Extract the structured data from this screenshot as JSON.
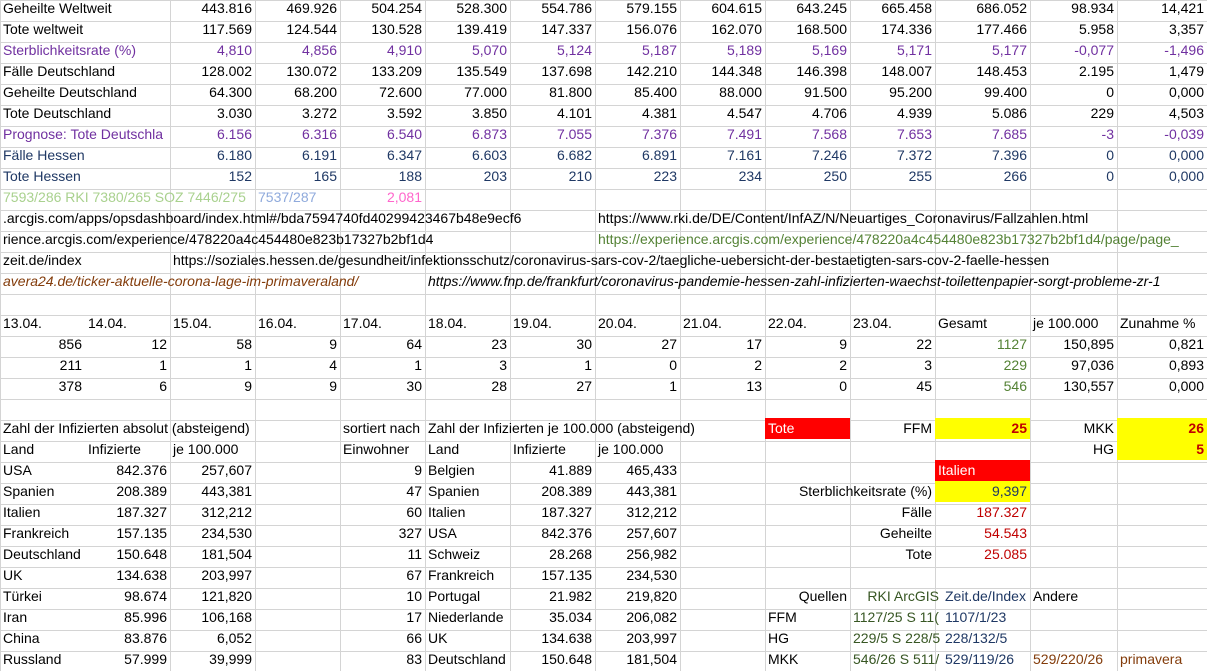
{
  "top": [
    {
      "label": "Geheilte Weltweit",
      "v": [
        "443.816",
        "469.926",
        "504.254",
        "528.300",
        "554.786",
        "579.155",
        "604.615",
        "643.245",
        "665.458",
        "686.052",
        "98.934",
        "14,421"
      ],
      "cls": ""
    },
    {
      "label": "Tote weltweit",
      "v": [
        "117.569",
        "124.544",
        "130.528",
        "139.419",
        "147.337",
        "156.076",
        "162.070",
        "168.500",
        "174.336",
        "177.466",
        "5.958",
        "3,357"
      ],
      "cls": ""
    },
    {
      "label": "Sterblichkeitsrate (%)",
      "v": [
        "4,810",
        "4,856",
        "4,910",
        "5,070",
        "5,124",
        "5,187",
        "5,189",
        "5,169",
        "5,171",
        "5,177",
        "-0,077",
        "-1,496"
      ],
      "cls": "purple"
    },
    {
      "label": "Fälle Deutschland",
      "v": [
        "128.002",
        "130.072",
        "133.209",
        "135.549",
        "137.698",
        "142.210",
        "144.348",
        "146.398",
        "148.007",
        "148.453",
        "2.195",
        "1,479"
      ],
      "cls": ""
    },
    {
      "label": "Geheilte Deutschland",
      "v": [
        "64.300",
        "68.200",
        "72.600",
        "77.000",
        "81.800",
        "85.400",
        "88.000",
        "91.500",
        "95.200",
        "99.400",
        "0",
        "0,000"
      ],
      "cls": ""
    },
    {
      "label": "Tote Deutschland",
      "v": [
        "3.030",
        "3.272",
        "3.592",
        "3.850",
        "4.101",
        "4.381",
        "4.547",
        "4.706",
        "4.939",
        "5.086",
        "229",
        "4,503"
      ],
      "cls": ""
    },
    {
      "label": "Prognose: Tote Deutschla",
      "v": [
        "6.156",
        "6.316",
        "6.540",
        "6.873",
        "7.055",
        "7.376",
        "7.491",
        "7.568",
        "7.653",
        "7.685",
        "-3",
        "-0,039"
      ],
      "cls": "purple"
    },
    {
      "label": "Fälle Hessen",
      "v": [
        "6.180",
        "6.191",
        "6.347",
        "6.603",
        "6.682",
        "6.891",
        "7.161",
        "7.246",
        "7.372",
        "7.396",
        "0",
        "0,000"
      ],
      "cls": "blue"
    },
    {
      "label": "Tote Hessen",
      "v": [
        "152",
        "165",
        "188",
        "203",
        "210",
        "223",
        "234",
        "250",
        "255",
        "266",
        "0",
        "0,000"
      ],
      "cls": "blue"
    }
  ],
  "notes": {
    "n1": "7593/286 RKI 7380/265 SOZ 7446/275",
    "n2": "7537/287",
    "n3": "2,081"
  },
  "links": {
    "l1a": ".arcgis.com/apps/opsdashboard/index.html#/bda7594740fd40299423467b48e9ecf6",
    "l1b": "https://www.rki.de/DE/Content/InfAZ/N/Neuartiges_Coronavirus/Fallzahlen.html",
    "l2a": "rience.arcgis.com/experience/478220a4c454480e823b17327b2bf1d4",
    "l2b": "https://experience.arcgis.com/experience/478220a4c454480e823b17327b2bf1d4/page/page_",
    "l3a": "zeit.de/index",
    "l3b": "https://soziales.hessen.de/gesundheit/infektionsschutz/coronavirus-sars-cov-2/taegliche-uebersicht-der-bestaetigten-sars-cov-2-faelle-hessen",
    "l4a": "avera24.de/ticker-aktuelle-corona-lage-im-primaveraland/",
    "l4b": "https://www.fnp.de/frankfurt/coronavirus-pandemie-hessen-zahl-infizierten-waechst-toilettenpapier-sorgt-probleme-zr-1"
  },
  "dates": {
    "cols": [
      "13.04.",
      "14.04.",
      "15.04.",
      "16.04.",
      "17.04.",
      "18.04.",
      "19.04.",
      "20.04.",
      "21.04.",
      "22.04.",
      "23.04."
    ],
    "gesamt": "Gesamt",
    "je": "je 100.000",
    "zunahme": "Zunahme %",
    "rows": [
      {
        "v": [
          "856",
          "12",
          "58",
          "9",
          "64",
          "23",
          "30",
          "27",
          "17",
          "9",
          "22"
        ],
        "g": "1127",
        "j": "150,895",
        "z": "0,821"
      },
      {
        "v": [
          "211",
          "1",
          "1",
          "4",
          "1",
          "3",
          "1",
          "0",
          "2",
          "2",
          "3"
        ],
        "g": "229",
        "j": "97,036",
        "z": "0,893"
      },
      {
        "v": [
          "378",
          "6",
          "9",
          "9",
          "30",
          "28",
          "27",
          "1",
          "13",
          "0",
          "45"
        ],
        "g": "546",
        "j": "130,557",
        "z": "0,000"
      }
    ]
  },
  "infizierte": {
    "title_abs": "Zahl der Infizierten absolut (absteigend)",
    "sorted": "sortiert nach",
    "title_je": "Zahl der Infizierten je 100.000 (absteigend)",
    "h_land": "Land",
    "h_inf": "Infizierte",
    "h_je": "je 100.000",
    "h_einw": "Einwohner",
    "abs": [
      [
        "USA",
        "842.376",
        "257,607"
      ],
      [
        "Spanien",
        "208.389",
        "443,381"
      ],
      [
        "Italien",
        "187.327",
        "312,212"
      ],
      [
        "Frankreich",
        "157.135",
        "234,530"
      ],
      [
        "Deutschland",
        "150.648",
        "181,504"
      ],
      [
        "UK",
        "134.638",
        "203,997"
      ],
      [
        "Türkei",
        "98.674",
        "121,820"
      ],
      [
        "Iran",
        "85.996",
        "106,168"
      ],
      [
        "China",
        "83.876",
        "6,052"
      ],
      [
        "Russland",
        "57.999",
        "39,999"
      ]
    ],
    "rel": [
      [
        "9",
        "Belgien",
        "41.889",
        "465,433"
      ],
      [
        "47",
        "Spanien",
        "208.389",
        "443,381"
      ],
      [
        "60",
        "Italien",
        "187.327",
        "312,212"
      ],
      [
        "327",
        "USA",
        "842.376",
        "257,607"
      ],
      [
        "11",
        "Schweiz",
        "28.268",
        "256,982"
      ],
      [
        "67",
        "Frankreich",
        "157.135",
        "234,530"
      ],
      [
        "10",
        "Portugal",
        "21.982",
        "219,820"
      ],
      [
        "17",
        "Niederlande",
        "35.034",
        "206,082"
      ],
      [
        "66",
        "UK",
        "134.638",
        "203,997"
      ],
      [
        "83",
        "Deutschland",
        "150.648",
        "181,504"
      ]
    ]
  },
  "side": {
    "tote": "Tote",
    "ffm": "FFM",
    "ffm_v": "25",
    "mkk": "MKK",
    "mkk_v": "26",
    "hg": "HG",
    "hg_v": "5",
    "italien": "Italien",
    "sterb": "Sterblichkeitsrate (%)",
    "sterb_v": "9,397",
    "faelle": "Fälle",
    "faelle_v": "187.327",
    "geheilte": "Geheilte",
    "geheilte_v": "54.543",
    "tote2": "Tote",
    "tote2_v": "25.085",
    "quellen": "Quellen",
    "rki": "RKI ArcGIS",
    "zeit": "Zeit.de/Index",
    "andere": "Andere",
    "q_ffm": "FFM",
    "q_ffm_a": "1127/25 S 11(",
    "q_ffm_b": "1107/1/23",
    "q_hg": "HG",
    "q_hg_a": "229/5 S 228/5",
    "q_hg_b": "228/132/5",
    "q_mkk": "MKK",
    "q_mkk_a": "546/26 S 511/",
    "q_mkk_b": "529/119/26",
    "q_mkk_c": "529/220/26",
    "q_mkk_d": "primavera"
  }
}
